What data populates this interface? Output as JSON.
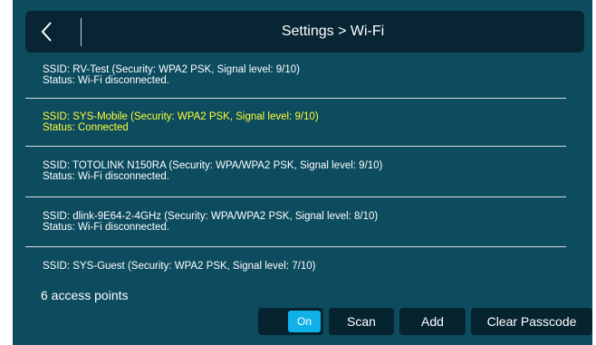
{
  "header": {
    "title": "Settings > Wi-Fi",
    "back_icon": "chevron-left-icon"
  },
  "access_points": [
    {
      "line1": "SSID: RV-Test (Security: WPA2 PSK, Signal level: 9/10)",
      "line2": "Status: Wi-Fi disconnected."
    },
    {
      "line1": "SSID: SYS-Mobile (Security: WPA2 PSK, Signal level: 9/10)",
      "line2": "Status: Connected"
    },
    {
      "line1": "SSID: TOTOLINK N150RA (Security: WPA/WPA2 PSK, Signal level: 9/10)",
      "line2": "Status: Wi-Fi disconnected."
    },
    {
      "line1": "SSID: dlink-9E64-2-4GHz (Security: WPA/WPA2 PSK, Signal level: 8/10)",
      "line2": "Status: Wi-Fi disconnected."
    },
    {
      "line1": "SSID: SYS-Guest (Security: WPA2 PSK, Signal level: 7/10)"
    }
  ],
  "count_label": "6 access points",
  "wifi_toggle": {
    "label": "On",
    "state": "on"
  },
  "buttons": {
    "scan": "Scan",
    "add": "Add",
    "clear_passcode": "Clear Passcode"
  },
  "colors": {
    "background": "#0d4b5f",
    "header_bar": "#082534",
    "connected_text": "#ffff3a",
    "toggle_on": "#10b0e8",
    "button_bg": "#062330"
  }
}
